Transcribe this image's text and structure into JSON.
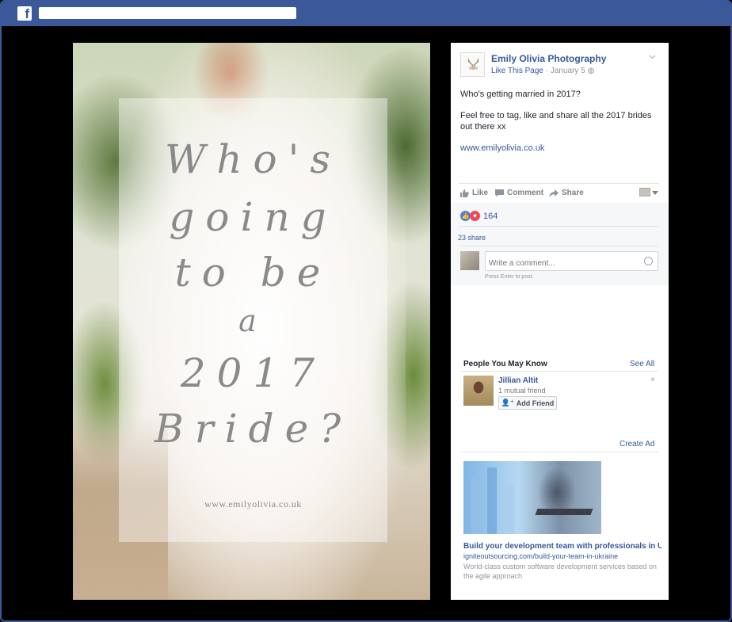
{
  "topbar": {
    "logo": "f",
    "search_value": ""
  },
  "photo_overlay": {
    "lines": [
      "Who's",
      "going",
      "to be",
      "a",
      "2017",
      "Bride?"
    ],
    "url": "www.emilyolivia.co.uk"
  },
  "post": {
    "page_name": "Emily Olivia Photography",
    "like_page": "Like This Page",
    "date": "January 5",
    "text_1": "Who's getting married in 2017?",
    "text_2": "Feel free to tag, like and share all the 2017 brides out there xx",
    "link": "www.emilyolivia.co.uk",
    "actions": {
      "like": "Like",
      "comment": "Comment",
      "share": "Share"
    },
    "reaction_count": "164",
    "shares": "23 share",
    "comment_placeholder": "Write a comment...",
    "press_enter": "Press Enter to post."
  },
  "pymk": {
    "heading": "People You May Know",
    "see_all": "See All",
    "person": {
      "name": "Jillian Altit",
      "mutual": "1 mutual friend",
      "add_label": "Add Friend",
      "close": "×"
    }
  },
  "ad": {
    "create_ad": "Create Ad",
    "title": "Build your development team with professionals in Uk...",
    "url": "igniteoutsourcing.com/build-your-team-in-ukraine",
    "description": "World-class custom software development services based on the agile approach"
  },
  "colors": {
    "brand": "#3b5998",
    "link": "#365899",
    "like_reaction": "#4c7fe0",
    "love_reaction": "#f2475b"
  }
}
